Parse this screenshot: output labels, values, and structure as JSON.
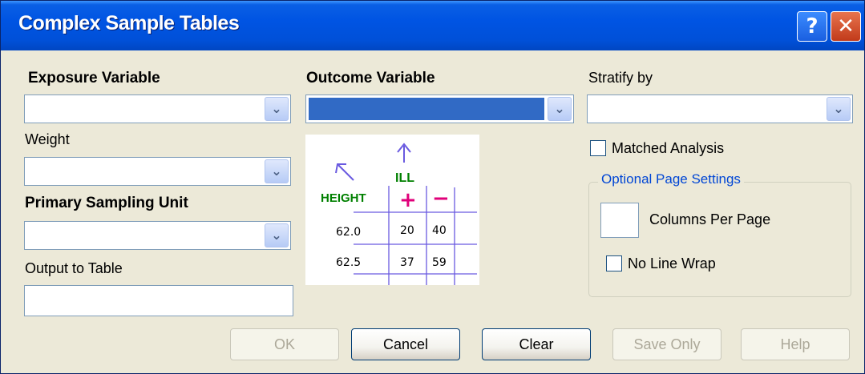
{
  "window": {
    "title": "Complex Sample Tables"
  },
  "titlebar": {
    "help_glyph": "?",
    "close_glyph": "✕"
  },
  "fields": {
    "exposure_label": "Exposure Variable",
    "outcome_label": "Outcome Variable",
    "stratify_label": "Stratify by",
    "weight_label": "Weight",
    "psu_label": "Primary Sampling Unit",
    "output_label": "Output to Table",
    "arrow_glyph": "⌄"
  },
  "options": {
    "matched_label": "Matched Analysis",
    "group_title": "Optional Page Settings",
    "columns_label": "Columns Per Page",
    "nowrap_label": "No Line Wrap"
  },
  "illustration": {
    "outcome_name": "ILL",
    "exposure_name": "HEIGHT",
    "plus": "+",
    "minus": "−",
    "rows": [
      {
        "value": "62.0",
        "pos": "20",
        "neg": "40"
      },
      {
        "value": "62.5",
        "pos": "37",
        "neg": "59"
      }
    ]
  },
  "buttons": {
    "ok": "OK",
    "cancel": "Cancel",
    "clear": "Clear",
    "save_only": "Save Only",
    "help": "Help"
  },
  "colors": {
    "titlebar": "#0054e3",
    "selection": "#316ac5",
    "group_title": "#0046d5",
    "ill_green": "#008000",
    "plus_magenta": "#e0007a",
    "sketch_blue": "#6a5ae0"
  }
}
